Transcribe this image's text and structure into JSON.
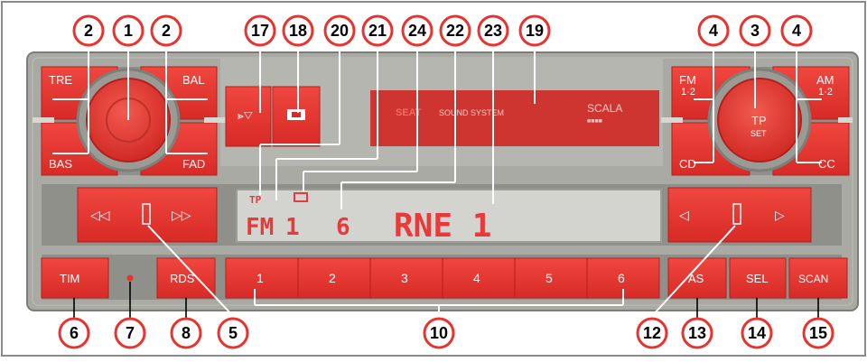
{
  "callouts": {
    "c1": "1",
    "c2a": "2",
    "c2b": "2",
    "c17": "17",
    "c18": "18",
    "c20": "20",
    "c21": "21",
    "c24": "24",
    "c22": "22",
    "c23": "23",
    "c19": "19",
    "c4a": "4",
    "c3": "3",
    "c4b": "4",
    "c6": "6",
    "c7": "7",
    "c8": "8",
    "c5": "5",
    "c10": "10",
    "c12": "12",
    "c13": "13",
    "c14": "14",
    "c15": "15"
  },
  "left_knob": {
    "tre": "TRE",
    "bal": "BAL",
    "bas": "BAS",
    "fad": "FAD"
  },
  "right_knob": {
    "fm": "FM",
    "fm_sub": "1·2",
    "am": "AM",
    "am_sub": "1·2",
    "cd": "CD",
    "cc": "CC",
    "tp": "TP",
    "tp_sub": "SET"
  },
  "brand": {
    "seat": "SEAT",
    "system": "SOUND SYSTEM",
    "model": "SCALA",
    "model_sub": "■■■■"
  },
  "display": {
    "tp": "TP",
    "band": "FM",
    "bank": "1",
    "preset": "6",
    "station": "RNE 1"
  },
  "buttons": {
    "tim": "TIM",
    "rds": "RDS",
    "as": "AS",
    "sel": "SEL",
    "scan": "SCAN"
  },
  "presets": [
    "1",
    "2",
    "3",
    "4",
    "5",
    "6"
  ],
  "colors": {
    "red": "#e8332f",
    "panel": "#a9aaa4",
    "display_bg": "#d3d4cf",
    "display_text": "#e83a3a"
  }
}
